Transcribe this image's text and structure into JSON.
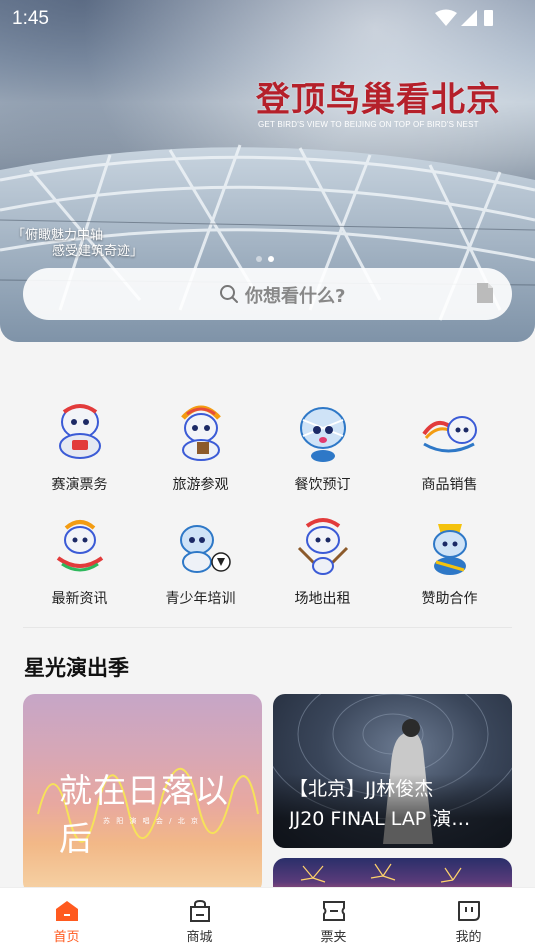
{
  "status_bar": {
    "time": "1:45"
  },
  "banner": {
    "title": "登顶鸟巢看北京",
    "subtitle": "GET BIRD'S VIEW TO BEIJING ON TOP OF BIRD'S NEST",
    "slogan_line1": "「俯瞰魅力中轴",
    "slogan_line2": "感受建筑奇迹」",
    "title_color": "#b5202a"
  },
  "search": {
    "placeholder": "你想看什么?"
  },
  "categories": [
    {
      "label": "赛演票务",
      "icon": "mascot-ticket-icon"
    },
    {
      "label": "旅游参观",
      "icon": "mascot-tour-icon"
    },
    {
      "label": "餐饮预订",
      "icon": "mascot-dining-icon"
    },
    {
      "label": "商品销售",
      "icon": "mascot-shop-icon"
    },
    {
      "label": "最新资讯",
      "icon": "mascot-news-icon"
    },
    {
      "label": "青少年培训",
      "icon": "mascot-training-icon"
    },
    {
      "label": "场地出租",
      "icon": "mascot-venue-icon"
    },
    {
      "label": "赞助合作",
      "icon": "mascot-sponsor-icon"
    }
  ],
  "section": {
    "title": "星光演出季"
  },
  "cards": {
    "left_title": "就在日落以后",
    "left_subtitle": "苏 阳 演 唱 会 / 北 京",
    "right_line1": "【北京】JJ林俊杰",
    "right_line2": "JJ20 FINAL LAP 演…"
  },
  "bottom_nav": {
    "items": [
      {
        "label": "首页",
        "icon": "home-icon",
        "active": true
      },
      {
        "label": "商城",
        "icon": "shopping-bag-icon",
        "active": false
      },
      {
        "label": "票夹",
        "icon": "ticket-icon",
        "active": false
      },
      {
        "label": "我的",
        "icon": "profile-icon",
        "active": false
      }
    ],
    "accent_color": "#ff5a1f"
  }
}
